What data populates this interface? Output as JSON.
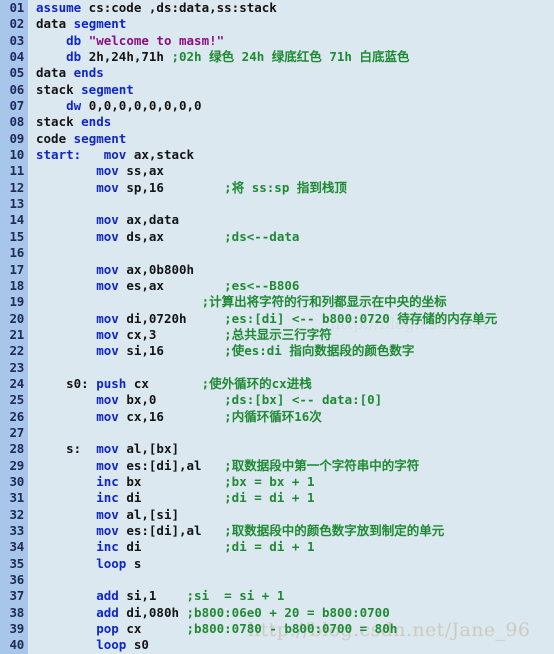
{
  "editor": {
    "language": "x86 Assembly (MASM)",
    "background_color": "#dbe8f0",
    "gutter_color": "#a8c6ea",
    "colors": {
      "keyword": "#0f26c8",
      "text": "#141414",
      "string": "#8a1080",
      "comment": "#1f8a33",
      "line_number": "#1d2a5c"
    },
    "first_line_number": "01",
    "last_line_number": "40",
    "total_lines": 40
  },
  "watermark": {
    "main": "http://blog.csdn.net/Jane_96",
    "faint": "http://blog.csdn.net"
  },
  "lines": [
    {
      "n": "01",
      "tokens": [
        {
          "t": "kw",
          "s": "assume"
        },
        {
          "t": "txt",
          "s": " cs:code ,ds:data,ss:stack"
        }
      ]
    },
    {
      "n": "02",
      "tokens": [
        {
          "t": "txt",
          "s": "data "
        },
        {
          "t": "kw",
          "s": "segment"
        }
      ]
    },
    {
      "n": "03",
      "tokens": [
        {
          "t": "txt",
          "s": "    "
        },
        {
          "t": "kw",
          "s": "db"
        },
        {
          "t": "txt",
          "s": " "
        },
        {
          "t": "str",
          "s": "\"welcome to masm!\""
        }
      ]
    },
    {
      "n": "04",
      "tokens": [
        {
          "t": "txt",
          "s": "    "
        },
        {
          "t": "kw",
          "s": "db"
        },
        {
          "t": "txt",
          "s": " 2h,24h,71h "
        },
        {
          "t": "cmt",
          "s": ";02h "
        },
        {
          "t": "cjk",
          "s": "绿色"
        },
        {
          "t": "cmt",
          "s": " 24h "
        },
        {
          "t": "cjk",
          "s": "绿底红色"
        },
        {
          "t": "cmt",
          "s": " 71h "
        },
        {
          "t": "cjk",
          "s": "白底蓝色"
        }
      ]
    },
    {
      "n": "05",
      "tokens": [
        {
          "t": "txt",
          "s": "data "
        },
        {
          "t": "kw",
          "s": "ends"
        }
      ]
    },
    {
      "n": "06",
      "tokens": [
        {
          "t": "txt",
          "s": "stack "
        },
        {
          "t": "kw",
          "s": "segment"
        }
      ]
    },
    {
      "n": "07",
      "tokens": [
        {
          "t": "txt",
          "s": "    "
        },
        {
          "t": "kw",
          "s": "dw"
        },
        {
          "t": "txt",
          "s": " 0,0,0,0,0,0,0,0"
        }
      ]
    },
    {
      "n": "08",
      "tokens": [
        {
          "t": "txt",
          "s": "stack "
        },
        {
          "t": "kw",
          "s": "ends"
        }
      ]
    },
    {
      "n": "09",
      "tokens": [
        {
          "t": "txt",
          "s": "code "
        },
        {
          "t": "kw",
          "s": "segment"
        }
      ]
    },
    {
      "n": "10",
      "tokens": [
        {
          "t": "kw",
          "s": "start:"
        },
        {
          "t": "txt",
          "s": "   "
        },
        {
          "t": "kw",
          "s": "mov"
        },
        {
          "t": "txt",
          "s": " ax,stack"
        }
      ]
    },
    {
      "n": "11",
      "tokens": [
        {
          "t": "txt",
          "s": "        "
        },
        {
          "t": "kw",
          "s": "mov"
        },
        {
          "t": "txt",
          "s": " ss,ax"
        }
      ]
    },
    {
      "n": "12",
      "tokens": [
        {
          "t": "txt",
          "s": "        "
        },
        {
          "t": "kw",
          "s": "mov"
        },
        {
          "t": "txt",
          "s": " sp,16        "
        },
        {
          "t": "cmt",
          "s": ";"
        },
        {
          "t": "cjk",
          "s": "将"
        },
        {
          "t": "cmt",
          "s": " ss:sp "
        },
        {
          "t": "cjk",
          "s": "指到栈顶"
        }
      ]
    },
    {
      "n": "13",
      "tokens": []
    },
    {
      "n": "14",
      "tokens": [
        {
          "t": "txt",
          "s": "        "
        },
        {
          "t": "kw",
          "s": "mov"
        },
        {
          "t": "txt",
          "s": " ax,data"
        }
      ]
    },
    {
      "n": "15",
      "tokens": [
        {
          "t": "txt",
          "s": "        "
        },
        {
          "t": "kw",
          "s": "mov"
        },
        {
          "t": "txt",
          "s": " ds,ax        "
        },
        {
          "t": "cmt",
          "s": ";ds<--data"
        }
      ]
    },
    {
      "n": "16",
      "tokens": []
    },
    {
      "n": "17",
      "tokens": [
        {
          "t": "txt",
          "s": "        "
        },
        {
          "t": "kw",
          "s": "mov"
        },
        {
          "t": "txt",
          "s": " ax,0b800h"
        }
      ]
    },
    {
      "n": "18",
      "tokens": [
        {
          "t": "txt",
          "s": "        "
        },
        {
          "t": "kw",
          "s": "mov"
        },
        {
          "t": "txt",
          "s": " es,ax        "
        },
        {
          "t": "cmt",
          "s": ";es<--B806"
        }
      ]
    },
    {
      "n": "19",
      "tokens": [
        {
          "t": "txt",
          "s": "                      "
        },
        {
          "t": "cmt",
          "s": ";"
        },
        {
          "t": "cjk",
          "s": "计算出将字符的行和列都显示在中央的坐标"
        }
      ]
    },
    {
      "n": "20",
      "tokens": [
        {
          "t": "txt",
          "s": "        "
        },
        {
          "t": "kw",
          "s": "mov"
        },
        {
          "t": "txt",
          "s": " di,0720h     "
        },
        {
          "t": "cmt",
          "s": ";es:[di] <-- b800:0720 "
        },
        {
          "t": "cjk",
          "s": "待存储的内存单元"
        }
      ]
    },
    {
      "n": "21",
      "tokens": [
        {
          "t": "txt",
          "s": "        "
        },
        {
          "t": "kw",
          "s": "mov"
        },
        {
          "t": "txt",
          "s": " cx,3         "
        },
        {
          "t": "cmt",
          "s": ";"
        },
        {
          "t": "cjk",
          "s": "总共显示三行字符"
        }
      ]
    },
    {
      "n": "22",
      "tokens": [
        {
          "t": "txt",
          "s": "        "
        },
        {
          "t": "kw",
          "s": "mov"
        },
        {
          "t": "txt",
          "s": " si,16        "
        },
        {
          "t": "cmt",
          "s": ";"
        },
        {
          "t": "cjk",
          "s": "使"
        },
        {
          "t": "cmt",
          "s": "es:di "
        },
        {
          "t": "cjk",
          "s": "指向数据段的颜色数字"
        }
      ]
    },
    {
      "n": "23",
      "tokens": []
    },
    {
      "n": "24",
      "tokens": [
        {
          "t": "txt",
          "s": "    s0: "
        },
        {
          "t": "kw",
          "s": "push"
        },
        {
          "t": "txt",
          "s": " cx       "
        },
        {
          "t": "cmt",
          "s": ";"
        },
        {
          "t": "cjk",
          "s": "使外循环的"
        },
        {
          "t": "cmt",
          "s": "cx"
        },
        {
          "t": "cjk",
          "s": "进栈"
        }
      ]
    },
    {
      "n": "25",
      "tokens": [
        {
          "t": "txt",
          "s": "        "
        },
        {
          "t": "kw",
          "s": "mov"
        },
        {
          "t": "txt",
          "s": " bx,0         "
        },
        {
          "t": "cmt",
          "s": ";ds:[bx] <-- data:[0]"
        }
      ]
    },
    {
      "n": "26",
      "tokens": [
        {
          "t": "txt",
          "s": "        "
        },
        {
          "t": "kw",
          "s": "mov"
        },
        {
          "t": "txt",
          "s": " cx,16        "
        },
        {
          "t": "cmt",
          "s": ";"
        },
        {
          "t": "cjk",
          "s": "内循环循环"
        },
        {
          "t": "cmt",
          "s": "16"
        },
        {
          "t": "cjk",
          "s": "次"
        }
      ]
    },
    {
      "n": "27",
      "tokens": []
    },
    {
      "n": "28",
      "tokens": [
        {
          "t": "txt",
          "s": "    s:  "
        },
        {
          "t": "kw",
          "s": "mov"
        },
        {
          "t": "txt",
          "s": " al,[bx]"
        }
      ]
    },
    {
      "n": "29",
      "tokens": [
        {
          "t": "txt",
          "s": "        "
        },
        {
          "t": "kw",
          "s": "mov"
        },
        {
          "t": "txt",
          "s": " es:[di],al   "
        },
        {
          "t": "cmt",
          "s": ";"
        },
        {
          "t": "cjk",
          "s": "取数据段中第一个字符串中的字符"
        }
      ]
    },
    {
      "n": "30",
      "tokens": [
        {
          "t": "txt",
          "s": "        "
        },
        {
          "t": "kw",
          "s": "inc"
        },
        {
          "t": "txt",
          "s": " bx           "
        },
        {
          "t": "cmt",
          "s": ";bx = bx + 1"
        }
      ]
    },
    {
      "n": "31",
      "tokens": [
        {
          "t": "txt",
          "s": "        "
        },
        {
          "t": "kw",
          "s": "inc"
        },
        {
          "t": "txt",
          "s": " di           "
        },
        {
          "t": "cmt",
          "s": ";di = di + 1"
        }
      ]
    },
    {
      "n": "32",
      "tokens": [
        {
          "t": "txt",
          "s": "        "
        },
        {
          "t": "kw",
          "s": "mov"
        },
        {
          "t": "txt",
          "s": " al,[si]"
        }
      ]
    },
    {
      "n": "33",
      "tokens": [
        {
          "t": "txt",
          "s": "        "
        },
        {
          "t": "kw",
          "s": "mov"
        },
        {
          "t": "txt",
          "s": " es:[di],al   "
        },
        {
          "t": "cmt",
          "s": ";"
        },
        {
          "t": "cjk",
          "s": "取数据段中的颜色数字放到制定的单元"
        }
      ]
    },
    {
      "n": "34",
      "tokens": [
        {
          "t": "txt",
          "s": "        "
        },
        {
          "t": "kw",
          "s": "inc"
        },
        {
          "t": "txt",
          "s": " di           "
        },
        {
          "t": "cmt",
          "s": ";di = di + 1"
        }
      ]
    },
    {
      "n": "35",
      "tokens": [
        {
          "t": "txt",
          "s": "        "
        },
        {
          "t": "kw",
          "s": "loop"
        },
        {
          "t": "txt",
          "s": " s"
        }
      ]
    },
    {
      "n": "36",
      "tokens": []
    },
    {
      "n": "37",
      "tokens": [
        {
          "t": "txt",
          "s": "        "
        },
        {
          "t": "kw",
          "s": "add"
        },
        {
          "t": "txt",
          "s": " si,1    "
        },
        {
          "t": "cmt",
          "s": ";si  = si + 1"
        }
      ]
    },
    {
      "n": "38",
      "tokens": [
        {
          "t": "txt",
          "s": "        "
        },
        {
          "t": "kw",
          "s": "add"
        },
        {
          "t": "txt",
          "s": " di,080h "
        },
        {
          "t": "cmt",
          "s": ";b800:06e0 + 20 = b800:0700"
        }
      ]
    },
    {
      "n": "39",
      "tokens": [
        {
          "t": "txt",
          "s": "        "
        },
        {
          "t": "kw",
          "s": "pop"
        },
        {
          "t": "txt",
          "s": " cx      "
        },
        {
          "t": "cmt",
          "s": ";b800:0780 - b800:0700 = 80h"
        }
      ]
    },
    {
      "n": "40",
      "tokens": [
        {
          "t": "txt",
          "s": "        "
        },
        {
          "t": "kw",
          "s": "loop"
        },
        {
          "t": "txt",
          "s": " s0"
        }
      ]
    }
  ]
}
